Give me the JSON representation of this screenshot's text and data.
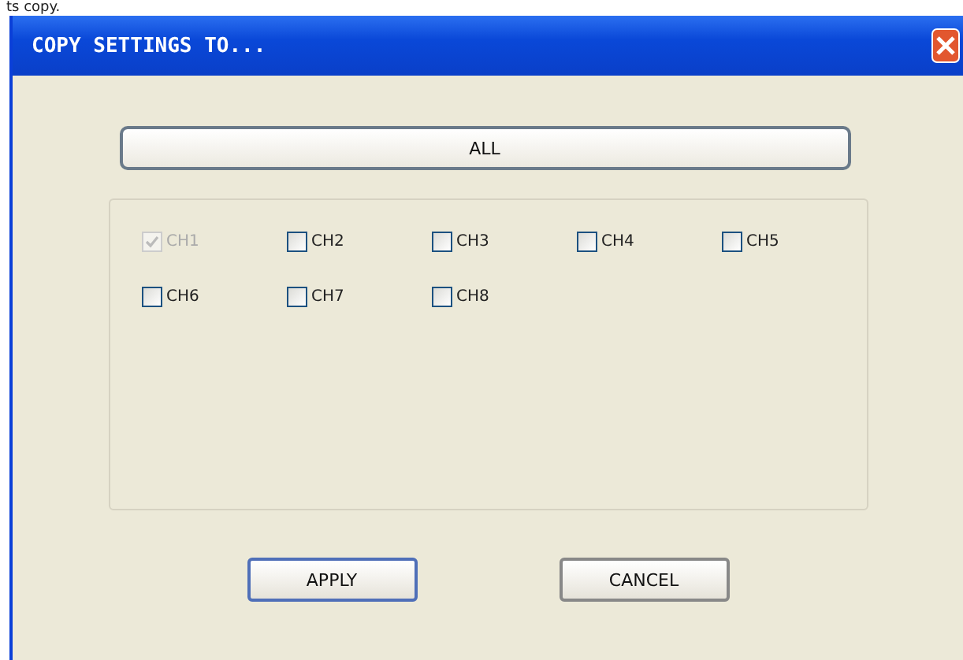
{
  "caption_fragment": "ts copy.",
  "window": {
    "title": "COPY SETTINGS TO..."
  },
  "all_button": "ALL",
  "channels": [
    {
      "label": "CH1",
      "checked": true,
      "disabled": true
    },
    {
      "label": "CH2",
      "checked": false,
      "disabled": false
    },
    {
      "label": "CH3",
      "checked": false,
      "disabled": false
    },
    {
      "label": "CH4",
      "checked": false,
      "disabled": false
    },
    {
      "label": "CH5",
      "checked": false,
      "disabled": false
    },
    {
      "label": "CH6",
      "checked": false,
      "disabled": false
    },
    {
      "label": "CH7",
      "checked": false,
      "disabled": false
    },
    {
      "label": "CH8",
      "checked": false,
      "disabled": false
    }
  ],
  "buttons": [
    {
      "label": "APPLY",
      "kind": "default"
    },
    {
      "label": "CANCEL",
      "kind": "normal"
    }
  ]
}
